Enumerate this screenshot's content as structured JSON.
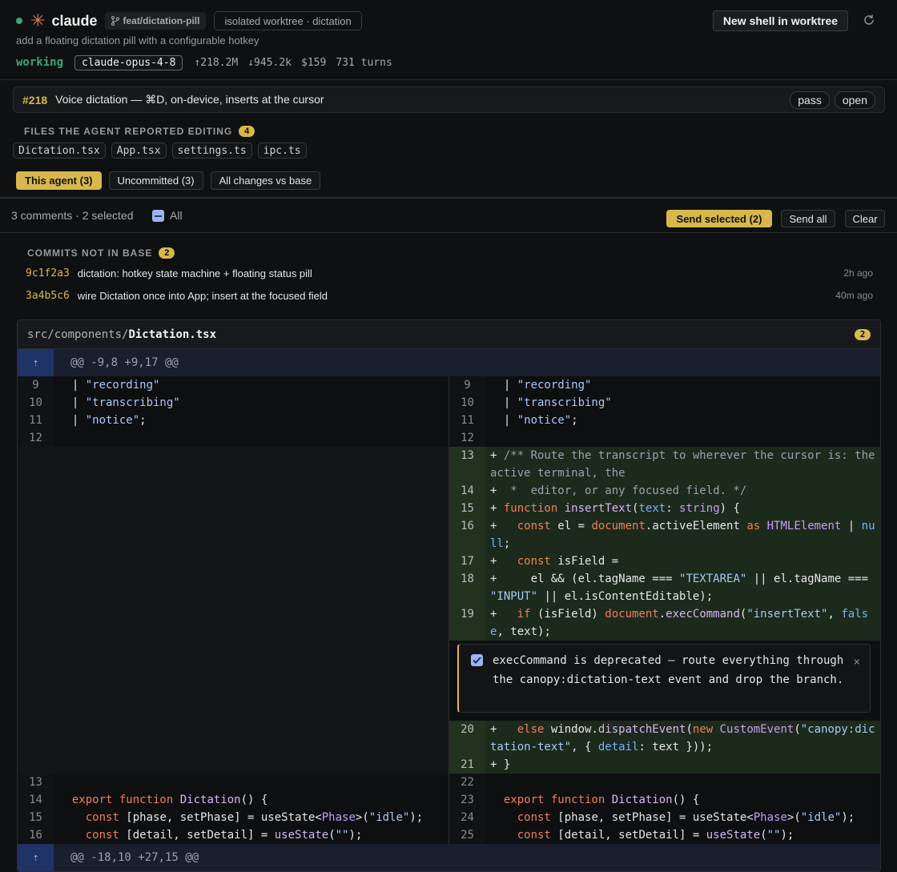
{
  "header": {
    "title": "claude",
    "branch": "feat/dictation-pill",
    "worktree": "isolated worktree · dictation",
    "subtitle": "add a floating dictation pill with a configurable hotkey",
    "status": "working",
    "model": "claude-opus-4-8",
    "tokens_up": "↑218.2M",
    "tokens_down": "↓945.2k",
    "cost": "$159",
    "turns": "731 turns",
    "new_shell_label": "New shell in worktree",
    "status_color": "#3aa676"
  },
  "issue": {
    "number": "#218",
    "title": "Voice dictation — ⌘D, on-device, inserts at the cursor",
    "tag_pass": "pass",
    "tag_open": "open"
  },
  "files": {
    "label": "FILES THE AGENT REPORTED EDITING",
    "count": "4",
    "items": [
      "Dictation.tsx",
      "App.tsx",
      "settings.ts",
      "ipc.ts"
    ]
  },
  "filters": {
    "this_agent": "This agent (3)",
    "uncommitted": "Uncommitted (3)",
    "all_changes": "All changes vs base"
  },
  "comments_bar": {
    "summary": "3 comments · 2 selected",
    "all_label": "All",
    "send_selected": "Send selected (2)",
    "send_all": "Send all",
    "clear": "Clear"
  },
  "commits": {
    "label": "COMMITS NOT IN BASE",
    "count": "2",
    "items": [
      {
        "sha": "9c1f2a3",
        "message": "dictation: hotkey state machine + floating status pill",
        "ago": "2h ago"
      },
      {
        "sha": "3a4b5c6",
        "message": "wire Dictation once into App; insert at the focused field",
        "ago": "40m ago"
      }
    ]
  },
  "diff": {
    "path": "src/components/",
    "file": "Dictation.tsx",
    "comment_count": "2",
    "hunk1": "@@ -9,8 +9,17 @@",
    "hunk2": "@@ -18,10 +27,15 @@",
    "comment_text": "execCommand is deprecated — route everything through the canopy:dictation-text event and drop the branch.",
    "left_nums": [
      "9",
      "10",
      "11",
      "12",
      "13",
      "14",
      "15",
      "16"
    ],
    "right_nums": [
      "9",
      "10",
      "11",
      "12",
      "13",
      "14",
      "15",
      "16",
      "17",
      "18",
      "19",
      "20",
      "21",
      "22",
      "23",
      "24",
      "25"
    ]
  },
  "accent_color": "#d8b84a"
}
